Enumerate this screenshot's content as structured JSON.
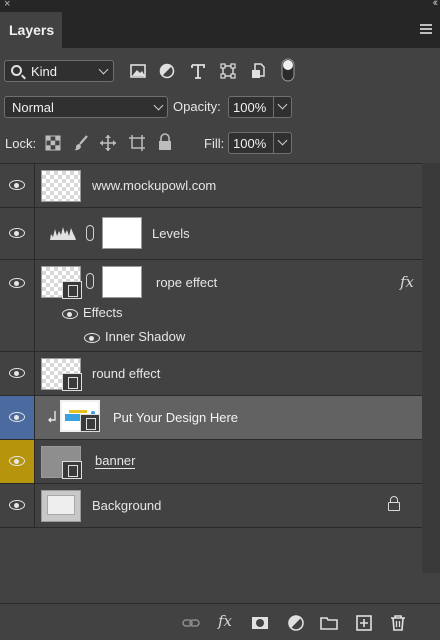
{
  "window": {
    "close_glyph": "×",
    "collapse_glyph": "‹‹"
  },
  "panel": {
    "tab_label": "Layers"
  },
  "filter": {
    "kind_label": "Kind",
    "icons": [
      "pixel-filter-icon",
      "adjustment-filter-icon",
      "type-filter-icon",
      "shape-filter-icon",
      "smart-object-filter-icon",
      "filter-toggle-icon"
    ]
  },
  "blending": {
    "mode": "Normal",
    "opacity_label": "Opacity:",
    "opacity_value": "100%"
  },
  "locks": {
    "label": "Lock:",
    "icons": [
      "lock-transparent-pixels-icon",
      "lock-image-pixels-icon",
      "lock-position-icon",
      "lock-artboard-icon",
      "lock-all-icon"
    ],
    "fill_label": "Fill:",
    "fill_value": "100%"
  },
  "layers": [
    {
      "name": "www.mockupowl.com",
      "type": "pixel"
    },
    {
      "name": "Levels",
      "type": "adjustment"
    },
    {
      "name": "rope effect",
      "type": "smart",
      "fx_label": "fx",
      "effects_label": "Effects",
      "effect_items": [
        "Inner Shadow"
      ]
    },
    {
      "name": "round  effect",
      "type": "smart"
    },
    {
      "name": "Put Your Design Here",
      "type": "smart",
      "selected": true,
      "clipped": true
    },
    {
      "name": "banner",
      "type": "smart",
      "visibility_color": "#b6950c"
    },
    {
      "name": "Background",
      "type": "pixel",
      "locked": true
    }
  ],
  "footer": {
    "icons": [
      "link-layers-icon",
      "add-layer-style-icon",
      "add-mask-icon",
      "new-adjustment-layer-icon",
      "new-group-icon",
      "new-layer-icon",
      "delete-layer-icon"
    ],
    "fx_label": "fx"
  },
  "colors": {
    "selected_row": "#626262",
    "selected_eye": "#4b6aa0",
    "banner_eye": "#b6950c",
    "panel_bg": "#424242"
  }
}
